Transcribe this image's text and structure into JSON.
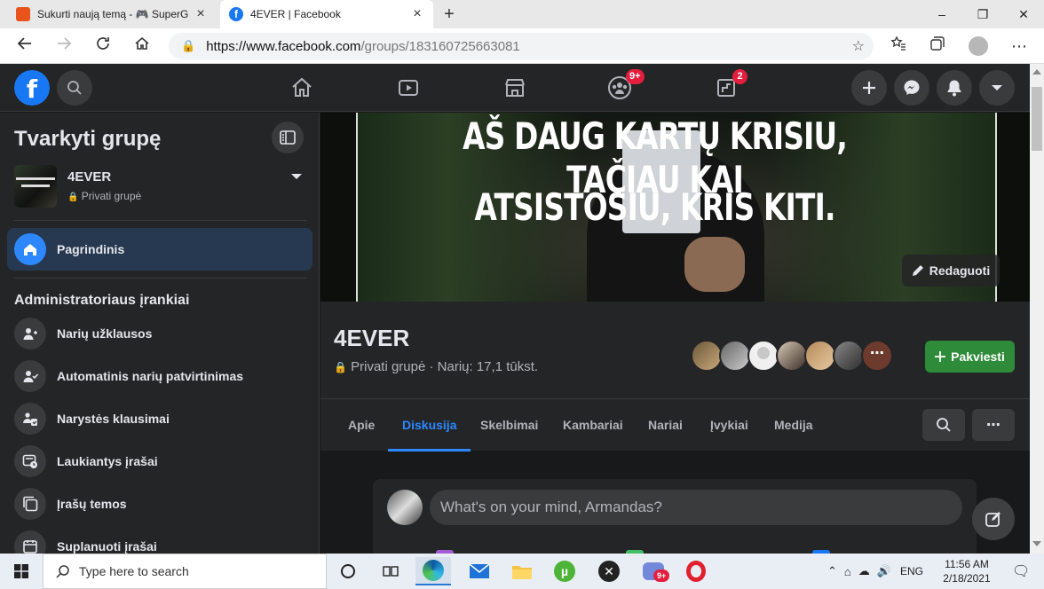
{
  "browser": {
    "tabs": [
      {
        "title": "Sukurti naują temą - 🎮 SuperG",
        "active": false
      },
      {
        "title": "4EVER | Facebook",
        "active": true
      }
    ],
    "url_host": "https://www.facebook.com",
    "url_path": "/groups/183160725663081"
  },
  "fbnav": {
    "groups_badge": "9+",
    "gaming_badge": "2"
  },
  "sidebar": {
    "title": "Tvarkyti grupę",
    "group_name": "4EVER",
    "group_privacy": "Privati grupė",
    "home_label": "Pagrindinis",
    "admin_heading": "Administratoriaus įrankiai",
    "items": [
      {
        "label": "Narių užklausos"
      },
      {
        "label": "Automatinis narių patvirtinimas"
      },
      {
        "label": "Narystės klausimai"
      },
      {
        "label": "Laukiantys įrašai"
      },
      {
        "label": "Įrašų temos"
      },
      {
        "label": "Suplanuoti įrašai"
      }
    ]
  },
  "cover": {
    "line1": "AŠ DAUG KARTŲ KRISIU, TAČIAU KAI",
    "line2": "ATSISTOSIU, KRIS KITI.",
    "edit_label": "Redaguoti"
  },
  "group": {
    "name": "4EVER",
    "meta": "Privati grupė · Narių: 17,1 tūkst.",
    "invite_label": "Pakviesti",
    "tabs": [
      "Apie",
      "Diskusija",
      "Skelbimai",
      "Kambariai",
      "Nariai",
      "Įvykiai",
      "Medija"
    ],
    "active_tab": "Diskusija"
  },
  "composer": {
    "placeholder": "What's on your mind, Armandas?"
  },
  "taskbar": {
    "search_placeholder": "Type here to search",
    "language": "ENG",
    "time": "11:56 AM",
    "date": "2/18/2021",
    "discord_badge": "9+"
  },
  "colors": {
    "fb_blue": "#1877f2",
    "link_blue": "#2d88ff",
    "invite_green": "#2e8b3a",
    "notif_red": "#e41e3f"
  }
}
